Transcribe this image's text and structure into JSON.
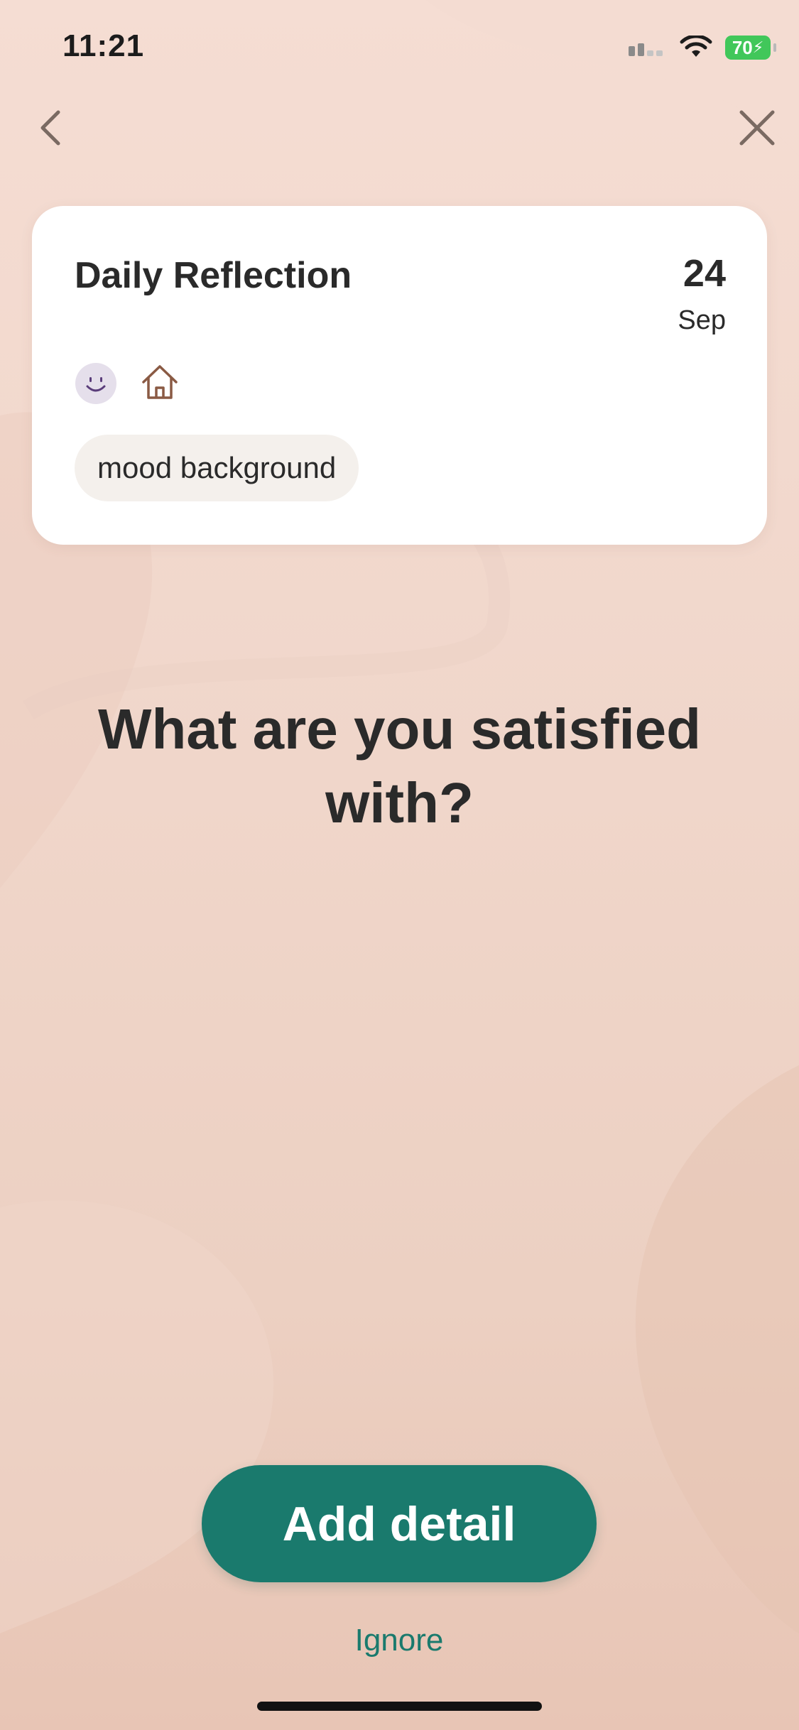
{
  "status_bar": {
    "time": "11:21",
    "battery": "70"
  },
  "nav": {
    "back_icon": "chevron-left-icon",
    "close_icon": "close-icon"
  },
  "card": {
    "title": "Daily Reflection",
    "day": "24",
    "month": "Sep",
    "mood_icon": "smiley-face-icon",
    "place_icon": "home-icon",
    "tag": "mood background"
  },
  "prompt": "What are you satisfied with?",
  "actions": {
    "add_detail": "Add detail",
    "ignore": "Ignore"
  },
  "colors": {
    "accent": "#1a7a6d",
    "card": "#ffffff",
    "background": "#f2d7cb",
    "mood_face": "#e5dfeb"
  }
}
